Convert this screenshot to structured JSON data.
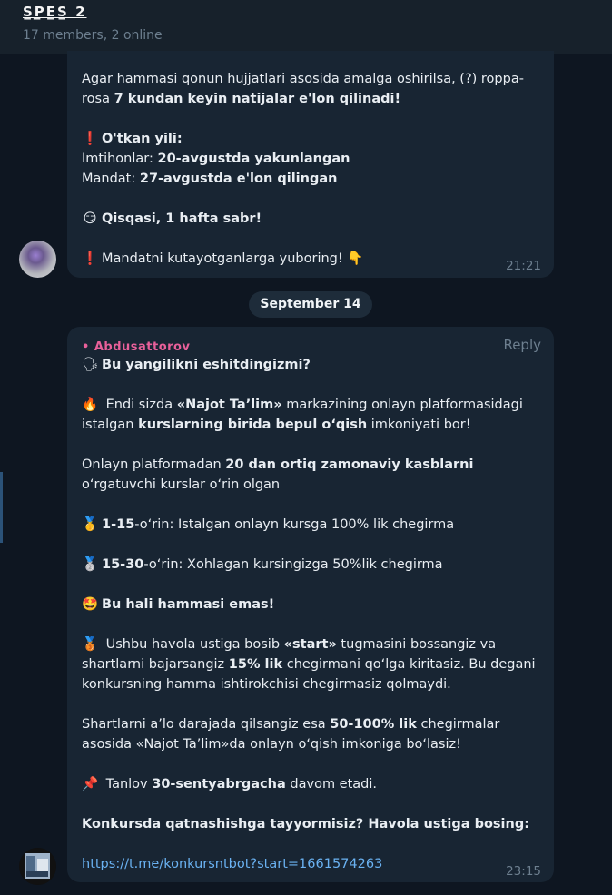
{
  "header": {
    "title": "S̲P̲E̲S̲ 2 ",
    "subtitle": "17 members, 2 online"
  },
  "message1": {
    "l1": "Agar hammasi qonun hujjatlari asosida amalga oshirilsa, (?) roppa-",
    "l2a": "rosa ",
    "l2b": "7 kundan keyin natijalar e'lon qilinadi!",
    "l3_emoji": "❗",
    "l3": "O'tkan yili:",
    "l4a": "Imtihonlar: ",
    "l4b": "20-avgustda yakunlangan",
    "l5a": "Mandat: ",
    "l5b": "27-avgustda e'lon qilingan",
    "l6_emoji": "😏",
    "l6": "Qisqasi, 1 hafta sabr!",
    "l7_emoji": "❗",
    "l7": "Mandatni kutayotganlarga yuboring! ",
    "l7_emoji2": "👇",
    "time": "21:21"
  },
  "date_separator": "September 14",
  "message2": {
    "sender": "• Abdusattorov",
    "reply": "Reply",
    "l1_emoji": "🗣",
    "l1": "Bu yangilikni eshitdingizmi?",
    "l2_emoji": "🔥",
    "l2a": " Endi sizda ",
    "l2b": "«Najot Ta’lim»",
    "l2c": " markazining onlayn platformasidagi",
    "l3a": "istalgan ",
    "l3b": "kurslarning birida bepul o‘qish",
    "l3c": " imkoniyati bor!",
    "l4a": "Onlayn platformadan ",
    "l4b": "20 dan ortiq zamonaviy kasblarni",
    "l5": "o‘rgatuvchi kurslar o‘rin olgan",
    "l6_emoji": "🥇",
    "l6a": "1-15",
    "l6b": "-o‘rin: Istalgan onlayn kursga 100% lik chegirma",
    "l7_emoji": "🥈",
    "l7a": "15-30",
    "l7b": "-o‘rin: Xohlagan kursingizga 50%lik chegirma",
    "l8_emoji": "🤩",
    "l8": "Bu hali hammasi emas!",
    "l9_emoji": "🥉",
    "l9a": " Ushbu havola ustiga bosib ",
    "l9b": "«start»",
    "l9c": " tugmasini bossangiz va",
    "l10a": "shartlarni bajarsangiz ",
    "l10b": "15% lik",
    "l10c": " chegirmani qo‘lga kiritasiz. Bu degani",
    "l11": "konkursning hamma ishtirokchisi chegirmasiz qolmaydi.",
    "l12": "Shartlarni a’lo darajada qilsangiz esa ",
    "l12b": "50-100% lik",
    "l12c": " chegirmalar",
    "l13": "asosida «Najot Ta’lim»da onlayn o‘qish imkoniga bo‘lasiz!",
    "l14_emoji": "📌",
    "l14a": " Tanlov ",
    "l14b": "30-sentyabrgacha",
    "l14c": " davom etadi.",
    "l15": "Konkursda qatnashishga tayyormisiz? Havola ustiga bosing:",
    "link": "https://t.me/konkursntbot?start=1661574263",
    "time": "23:15"
  },
  "colors": {
    "background": "#0e1621",
    "bubble": "#182533",
    "link": "#6ab2f2",
    "sender": "#e8609a"
  }
}
